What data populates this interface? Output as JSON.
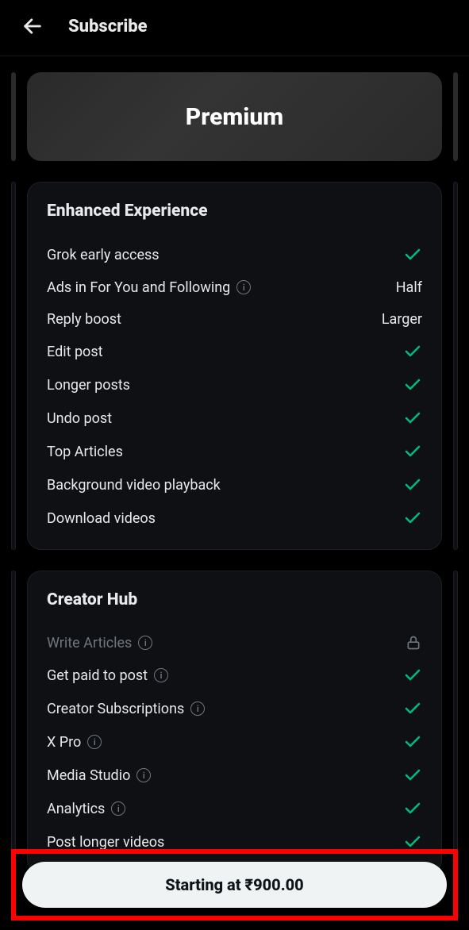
{
  "header": {
    "title": "Subscribe"
  },
  "tier": {
    "label": "Premium"
  },
  "sections": {
    "enhanced": {
      "title": "Enhanced Experience",
      "items": {
        "grok": {
          "label": "Grok early access",
          "right": "check"
        },
        "ads": {
          "label": "Ads in For You and Following",
          "right_text": "Half",
          "info": true
        },
        "reply": {
          "label": "Reply boost",
          "right_text": "Larger"
        },
        "edit": {
          "label": "Edit post",
          "right": "check"
        },
        "longer": {
          "label": "Longer posts",
          "right": "check"
        },
        "undo": {
          "label": "Undo post",
          "right": "check"
        },
        "top": {
          "label": "Top Articles",
          "right": "check"
        },
        "bgvideo": {
          "label": "Background video playback",
          "right": "check"
        },
        "download": {
          "label": "Download videos",
          "right": "check"
        }
      }
    },
    "creator": {
      "title": "Creator Hub",
      "items": {
        "write": {
          "label": "Write Articles",
          "right": "lock",
          "info": true,
          "dim": true
        },
        "paid": {
          "label": "Get paid to post",
          "right": "check",
          "info": true
        },
        "subs": {
          "label": "Creator Subscriptions",
          "right": "check",
          "info": true
        },
        "xpro": {
          "label": "X Pro",
          "right": "check",
          "info": true
        },
        "media": {
          "label": "Media Studio",
          "right": "check",
          "info": true
        },
        "analytics": {
          "label": "Analytics",
          "right": "check",
          "info": true
        },
        "longvid": {
          "label": "Post longer videos",
          "right": "check"
        }
      }
    }
  },
  "cta": {
    "label": "Starting at ₹900.00"
  }
}
